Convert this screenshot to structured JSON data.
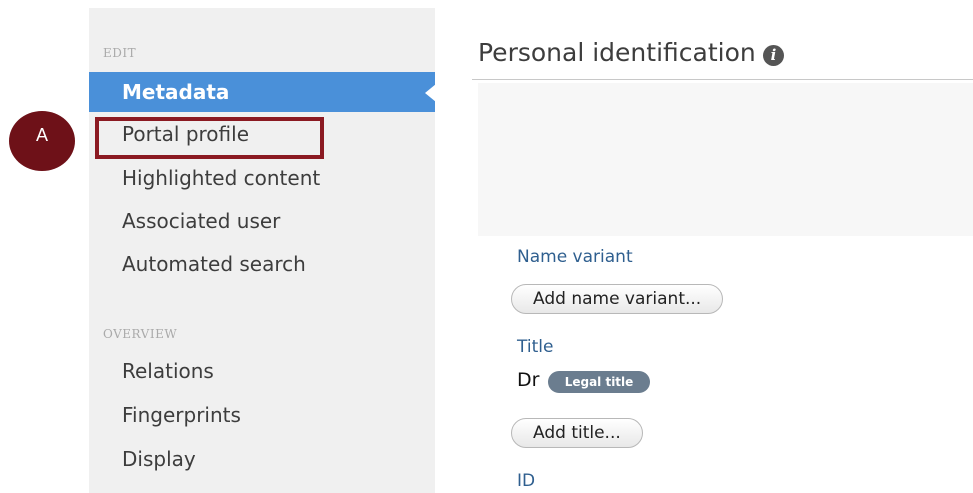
{
  "sidebar": {
    "edit_section_label": "EDIT",
    "edit_items": [
      {
        "label": "Metadata",
        "active": true
      },
      {
        "label": "Portal profile",
        "active": false
      },
      {
        "label": "Highlighted content",
        "active": false
      },
      {
        "label": "Associated user",
        "active": false
      },
      {
        "label": "Automated search",
        "active": false
      }
    ],
    "overview_section_label": "OVERVIEW",
    "overview_items": [
      {
        "label": "Relations"
      },
      {
        "label": "Fingerprints"
      },
      {
        "label": "Display"
      }
    ]
  },
  "annotation": {
    "marker_label": "A",
    "color": "#8b1a22"
  },
  "main": {
    "title": "Personal identification",
    "info_icon": "info-icon",
    "name_variant_label": "Name variant",
    "add_name_variant_button": "Add name variant...",
    "title_label": "Title",
    "title_value": "Dr",
    "title_badge": "Legal title",
    "add_title_button": "Add title...",
    "id_label": "ID"
  },
  "colors": {
    "active_nav": "#4a90d9",
    "field_label": "#2f5f8f",
    "badge": "#6b7d8f"
  }
}
